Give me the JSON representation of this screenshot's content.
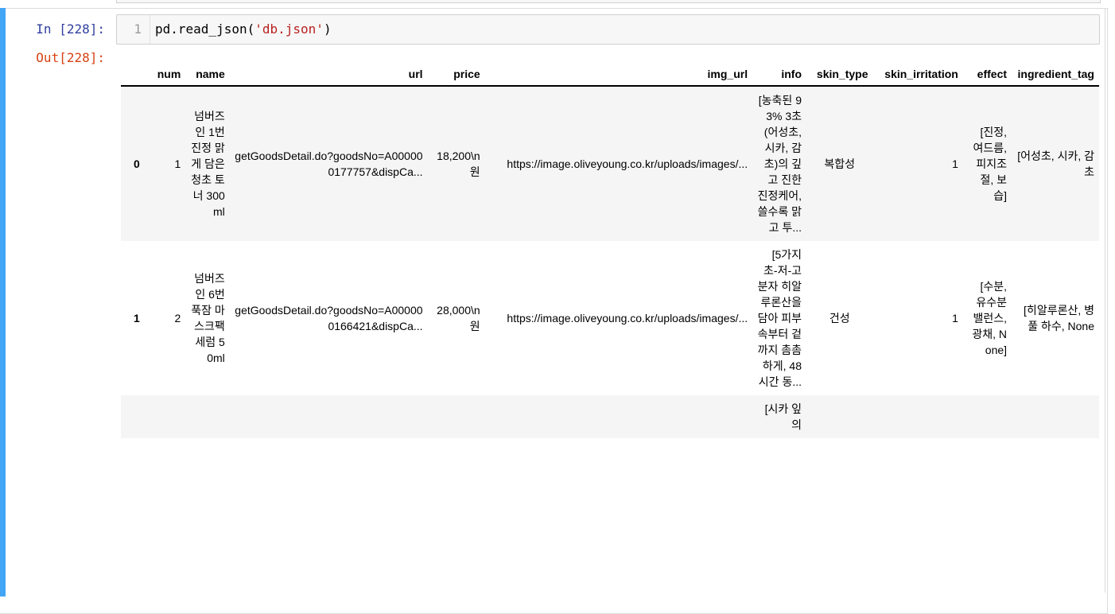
{
  "prompts": {
    "in": "In [228]:",
    "out": "Out[228]:"
  },
  "code": {
    "line_number": "1",
    "prefix": "pd.read_json(",
    "string": "'db.json'",
    "suffix": ")"
  },
  "colors": {
    "cell_bar": "#42a5f5",
    "in_prompt": "#303f9f",
    "out_prompt": "#d84315",
    "string": "#ba2121"
  },
  "table": {
    "columns": [
      "",
      "num",
      "name",
      "url",
      "price",
      "img_url",
      "info",
      "skin_type",
      "skin_irritation",
      "effect",
      "ingredient_tag"
    ],
    "rows": [
      {
        "index": "0",
        "num": "1",
        "name": "넘버즈인 1번 진정 맑게 담은 청초 토너 300ml",
        "url": "getGoodsDetail.do?goodsNo=A000000177757&dispCa...",
        "price": "18,200\\n원",
        "img_url": "https://image.oliveyoung.co.kr/uploads/images/...",
        "info": "[농축된 93% 3초(어성초, 시카, 감초)의 깊고 진한 진정케어, 쓸수록 맑고 투...",
        "skin_type": "복합성",
        "skin_irritation": "1",
        "effect": "[진정, 여드름, 피지조절, 보습]",
        "ingredient_tag": "[어성초, 시카, 감초"
      },
      {
        "index": "1",
        "num": "2",
        "name": "넘버즈인 6번 푹잠 마스크팩 세럼 50ml",
        "url": "getGoodsDetail.do?goodsNo=A000000166421&dispCa...",
        "price": "28,000\\n원",
        "img_url": "https://image.oliveyoung.co.kr/uploads/images/...",
        "info": "[5가지 초-저-고분자 히알루론산을 담아 피부 속부터 겉까지 촘촘하게, 48시간 동...",
        "skin_type": "건성",
        "skin_irritation": "1",
        "effect": "[수분, 유수분 밸런스, 광채, None]",
        "ingredient_tag": "[히알루론산, 병풀 하수, None"
      },
      {
        "index": "",
        "num": "",
        "name": "",
        "url": "",
        "price": "",
        "img_url": "",
        "info": "[시카 잎의",
        "skin_type": "",
        "skin_irritation": "",
        "effect": "",
        "ingredient_tag": ""
      }
    ]
  }
}
